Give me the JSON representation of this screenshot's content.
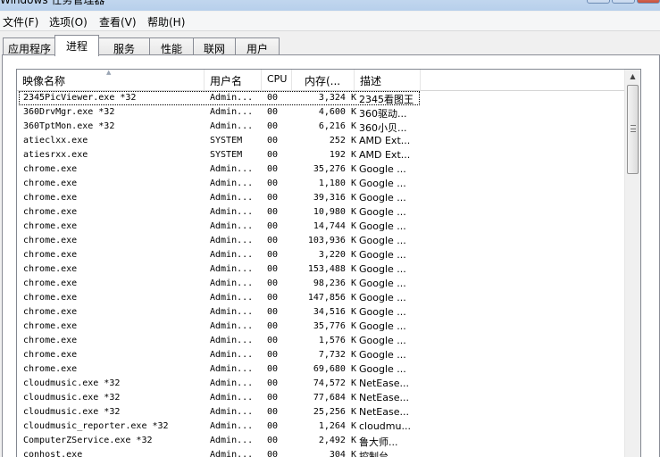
{
  "window": {
    "title": "Windows 任务管理器"
  },
  "menu": [
    {
      "label": "文件(F)"
    },
    {
      "label": "选项(O)"
    },
    {
      "label": "查看(V)"
    },
    {
      "label": "帮助(H)"
    }
  ],
  "tabs": [
    {
      "label": "应用程序"
    },
    {
      "label": "进程"
    },
    {
      "label": "服务"
    },
    {
      "label": "性能"
    },
    {
      "label": "联网"
    },
    {
      "label": "用户"
    }
  ],
  "active_tab": "进程",
  "columns": {
    "name": "映像名称",
    "user": "用户名",
    "cpu": "CPU",
    "memory": "内存(...",
    "description": "描述"
  },
  "processes": [
    {
      "name": "2345PicViewer.exe *32",
      "user": "Admin...",
      "cpu": "00",
      "mem": "3,324 K",
      "desc": "2345看图王"
    },
    {
      "name": "360DrvMgr.exe *32",
      "user": "Admin...",
      "cpu": "00",
      "mem": "4,600 K",
      "desc": "360驱动..."
    },
    {
      "name": "360TptMon.exe *32",
      "user": "Admin...",
      "cpu": "00",
      "mem": "6,216 K",
      "desc": "360小贝..."
    },
    {
      "name": "atieclxx.exe",
      "user": "SYSTEM",
      "cpu": "00",
      "mem": "252 K",
      "desc": "AMD Ext..."
    },
    {
      "name": "atiesrxx.exe",
      "user": "SYSTEM",
      "cpu": "00",
      "mem": "192 K",
      "desc": "AMD Ext..."
    },
    {
      "name": "chrome.exe",
      "user": "Admin...",
      "cpu": "00",
      "mem": "35,276 K",
      "desc": "Google ..."
    },
    {
      "name": "chrome.exe",
      "user": "Admin...",
      "cpu": "00",
      "mem": "1,180 K",
      "desc": "Google ..."
    },
    {
      "name": "chrome.exe",
      "user": "Admin...",
      "cpu": "00",
      "mem": "39,316 K",
      "desc": "Google ..."
    },
    {
      "name": "chrome.exe",
      "user": "Admin...",
      "cpu": "00",
      "mem": "10,980 K",
      "desc": "Google ..."
    },
    {
      "name": "chrome.exe",
      "user": "Admin...",
      "cpu": "00",
      "mem": "14,744 K",
      "desc": "Google ..."
    },
    {
      "name": "chrome.exe",
      "user": "Admin...",
      "cpu": "00",
      "mem": "103,936 K",
      "desc": "Google ..."
    },
    {
      "name": "chrome.exe",
      "user": "Admin...",
      "cpu": "00",
      "mem": "3,220 K",
      "desc": "Google ..."
    },
    {
      "name": "chrome.exe",
      "user": "Admin...",
      "cpu": "00",
      "mem": "153,488 K",
      "desc": "Google ..."
    },
    {
      "name": "chrome.exe",
      "user": "Admin...",
      "cpu": "00",
      "mem": "98,236 K",
      "desc": "Google ..."
    },
    {
      "name": "chrome.exe",
      "user": "Admin...",
      "cpu": "00",
      "mem": "147,856 K",
      "desc": "Google ..."
    },
    {
      "name": "chrome.exe",
      "user": "Admin...",
      "cpu": "00",
      "mem": "34,516 K",
      "desc": "Google ..."
    },
    {
      "name": "chrome.exe",
      "user": "Admin...",
      "cpu": "00",
      "mem": "35,776 K",
      "desc": "Google ..."
    },
    {
      "name": "chrome.exe",
      "user": "Admin...",
      "cpu": "00",
      "mem": "1,576 K",
      "desc": "Google ..."
    },
    {
      "name": "chrome.exe",
      "user": "Admin...",
      "cpu": "00",
      "mem": "7,732 K",
      "desc": "Google ..."
    },
    {
      "name": "chrome.exe",
      "user": "Admin...",
      "cpu": "00",
      "mem": "69,680 K",
      "desc": "Google ..."
    },
    {
      "name": "cloudmusic.exe *32",
      "user": "Admin...",
      "cpu": "00",
      "mem": "74,572 K",
      "desc": "NetEase..."
    },
    {
      "name": "cloudmusic.exe *32",
      "user": "Admin...",
      "cpu": "00",
      "mem": "77,684 K",
      "desc": "NetEase..."
    },
    {
      "name": "cloudmusic.exe *32",
      "user": "Admin...",
      "cpu": "00",
      "mem": "25,256 K",
      "desc": "NetEase..."
    },
    {
      "name": "cloudmusic_reporter.exe *32",
      "user": "Admin...",
      "cpu": "00",
      "mem": "1,264 K",
      "desc": "cloudmu..."
    },
    {
      "name": "ComputerZService.exe *32",
      "user": "Admin...",
      "cpu": "00",
      "mem": "2,492 K",
      "desc": "鲁大师..."
    },
    {
      "name": "conhost.exe",
      "user": "Admin...",
      "cpu": "00",
      "mem": "304 K",
      "desc": "控制台..."
    }
  ],
  "selected_index": 0,
  "icons": {
    "sort": "sort-ascending-icon",
    "scroll_up": "scroll-up-arrow-icon",
    "scroll_grip": "scroll-grip-icon"
  }
}
